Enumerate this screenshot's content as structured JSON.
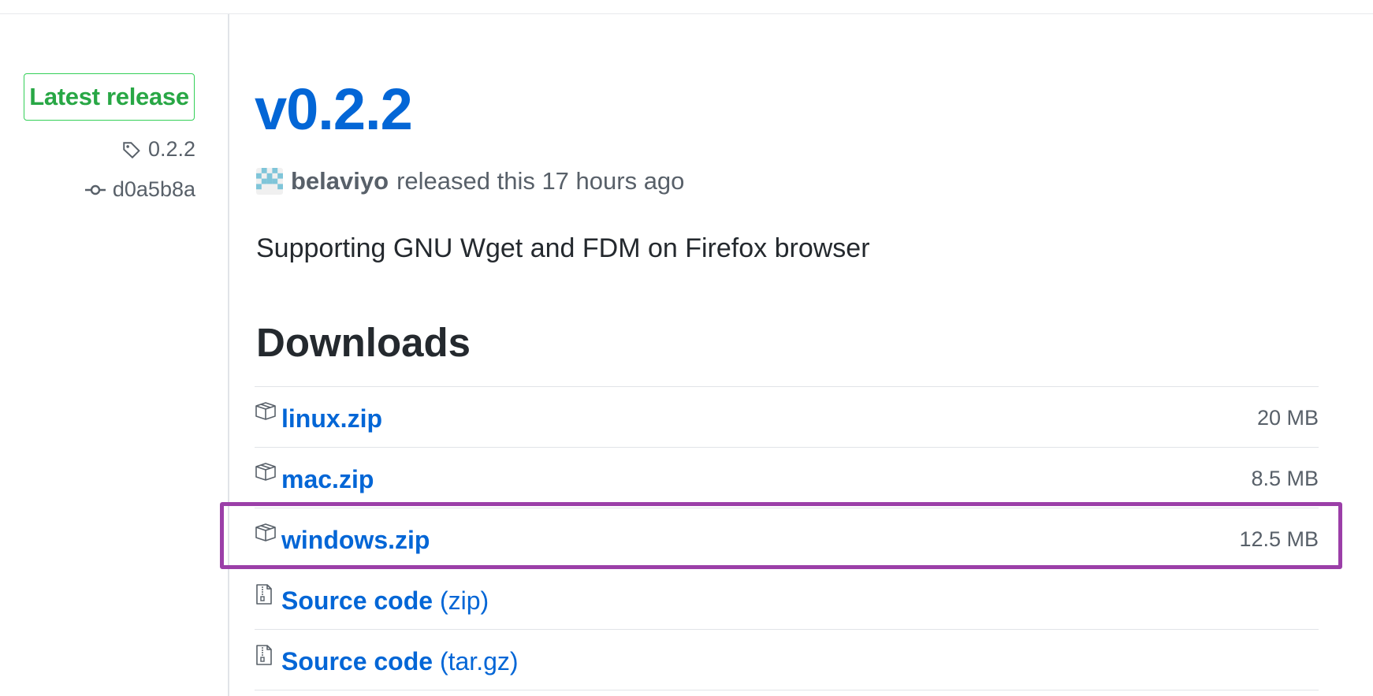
{
  "sidebar": {
    "badge_label": "Latest release",
    "tag": {
      "icon": "tag-icon",
      "label": "0.2.2"
    },
    "commit": {
      "icon": "commit-icon",
      "label": "d0a5b8a"
    }
  },
  "release": {
    "title": "v0.2.2",
    "author": "belaviyo",
    "released_text": "released this 17 hours ago",
    "description": "Supporting GNU Wget and FDM on Firefox browser"
  },
  "downloads": {
    "heading": "Downloads",
    "items": [
      {
        "icon": "package-icon",
        "name": "linux.zip",
        "suffix": "",
        "size": "20 MB"
      },
      {
        "icon": "package-icon",
        "name": "mac.zip",
        "suffix": "",
        "size": "8.5 MB"
      },
      {
        "icon": "package-icon",
        "name": "windows.zip",
        "suffix": "",
        "size": "12.5 MB",
        "highlighted": true
      },
      {
        "icon": "file-zip-icon",
        "name": "Source code",
        "suffix": " (zip)",
        "size": ""
      },
      {
        "icon": "file-zip-icon",
        "name": "Source code",
        "suffix": " (tar.gz)",
        "size": ""
      }
    ]
  },
  "colors": {
    "link": "#0366d6",
    "badge_green": "#28a745",
    "highlight_purple": "#9b3fa8",
    "muted_text": "#586069"
  }
}
